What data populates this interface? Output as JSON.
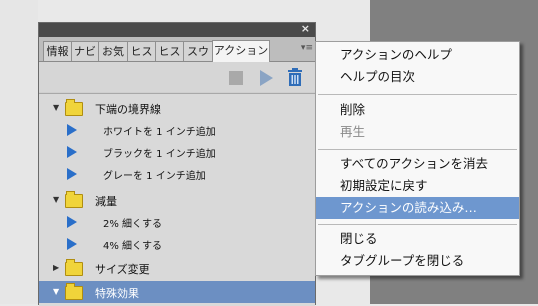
{
  "tabs": [
    "情報",
    "ナビ",
    "お気",
    "ヒス",
    "ヒス",
    "スウ",
    "アクション"
  ],
  "panel_menu_icon": "≡",
  "close_glyph": "×",
  "groups": [
    {
      "label": "下端の境界線",
      "items": [
        "ホワイトを 1 インチ追加",
        "ブラックを 1 インチ追加",
        "グレーを 1 インチ追加"
      ]
    },
    {
      "label": "減量",
      "items": [
        "2% 細くする",
        "4% 細くする"
      ]
    },
    {
      "label": "サイズ変更"
    },
    {
      "label": "特殊効果"
    }
  ],
  "menu": {
    "help": "アクションのヘルプ",
    "toc": "ヘルプの目次",
    "delete": "削除",
    "play": "再生",
    "clear_all": "すべてのアクションを消去",
    "reset": "初期設定に戻す",
    "load": "アクションの読み込み…",
    "close": "閉じる",
    "close_tab_group": "タブグループを閉じる"
  },
  "colors": {
    "selected_row": "#6c8fc2",
    "menu_highlight": "#6e97cf",
    "folder": "#f0d43a",
    "play_icon": "#2a6fc9"
  }
}
